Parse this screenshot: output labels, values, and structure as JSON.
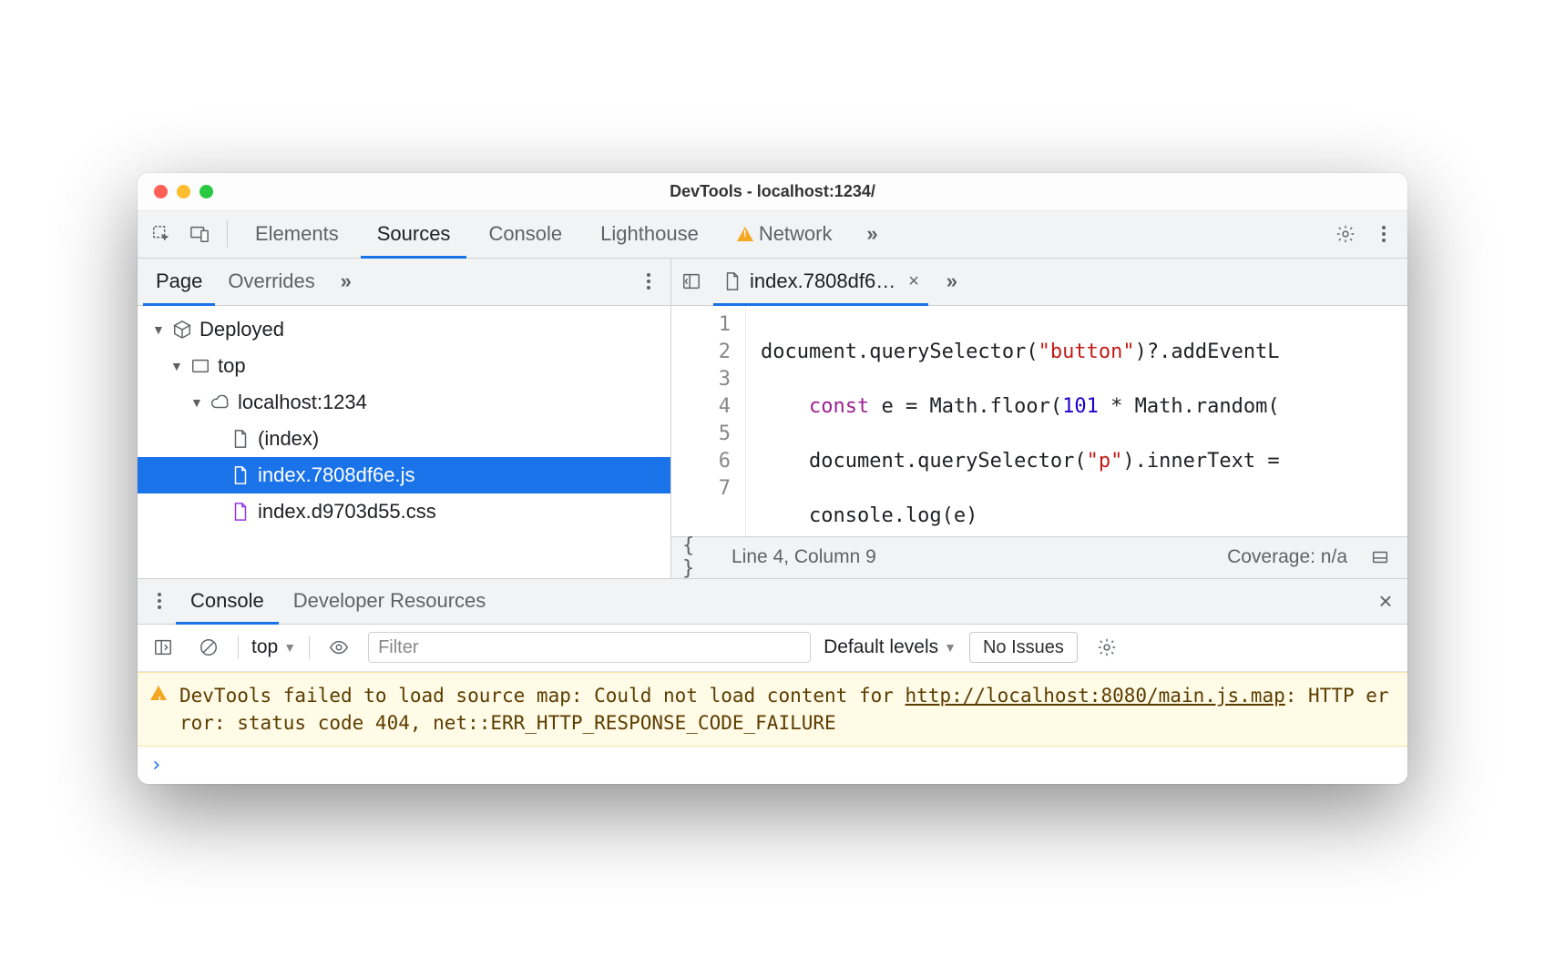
{
  "window": {
    "title": "DevTools - localhost:1234/"
  },
  "tabs": {
    "elements": "Elements",
    "sources": "Sources",
    "console": "Console",
    "lighthouse": "Lighthouse",
    "network": "Network"
  },
  "sidebar": {
    "tab_page": "Page",
    "tab_overrides": "Overrides",
    "tree": {
      "deployed": "Deployed",
      "top": "top",
      "origin": "localhost:1234",
      "index": "(index)",
      "file_js": "index.7808df6e.js",
      "file_css": "index.d9703d55.css"
    }
  },
  "editor": {
    "tab_label": "index.7808df6…",
    "lines": [
      "1",
      "2",
      "3",
      "4",
      "5",
      "6",
      "7"
    ],
    "code": {
      "l1a": "document.querySelector(",
      "l1b": "\"button\"",
      "l1c": ")?.addEventL",
      "l2a": "    ",
      "l2b": "const",
      "l2c": " e = Math.floor(",
      "l2d": "101",
      "l2e": " * Math.random(",
      "l3a": "    document.querySelector(",
      "l3b": "\"p\"",
      "l3c": ").innerText =",
      "l4": "    console.log(e)",
      "l5": "}",
      "l6": "));",
      "l7": ""
    },
    "status_left": "Line 4, Column 9",
    "status_right": "Coverage: n/a"
  },
  "drawer": {
    "tab_console": "Console",
    "tab_devres": "Developer Resources"
  },
  "console": {
    "context": "top",
    "filter_placeholder": "Filter",
    "levels": "Default levels",
    "issues": "No Issues",
    "warning_prefix": "DevTools failed to load source map: Could not load content for ",
    "warning_link": "http://localhost:8080/main.js.map",
    "warning_suffix": ": HTTP error: status code 404, net::ERR_HTTP_RESPONSE_CODE_FAILURE"
  }
}
